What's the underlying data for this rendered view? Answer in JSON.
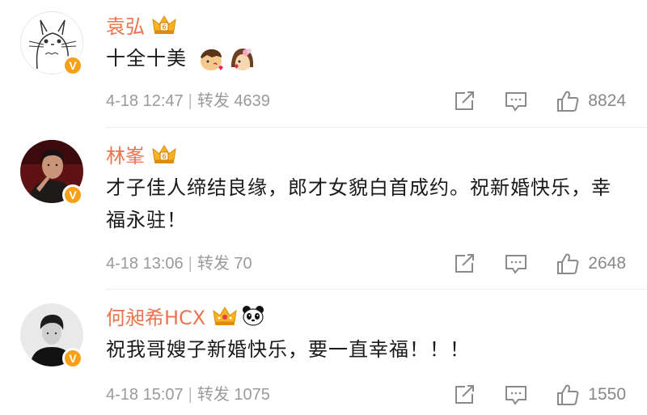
{
  "comments": [
    {
      "author": "袁弘",
      "text": "十全十美",
      "emojis": [
        "kiss-boy-emoji",
        "kiss-girl-emoji"
      ],
      "time": "4-18 12:47",
      "repost_label": "转发",
      "repost_count": "4639",
      "like_count": "8824",
      "avatar": "totoro-sketch-avatar"
    },
    {
      "author": "林峯",
      "text": "才子佳人缔结良缘，郎才女貌白首成约。祝新婚快乐，幸福永驻！",
      "time": "4-18 13:06",
      "repost_label": "转发",
      "repost_count": "70",
      "like_count": "2648",
      "avatar": "man-photo-avatar"
    },
    {
      "author": "何昶希HCX",
      "text": "祝我哥嫂子新婚快乐，要一直幸福！！！",
      "time": "4-18 15:07",
      "repost_label": "转发",
      "repost_count": "1075",
      "like_count": "1550",
      "avatar": "bw-portrait-avatar"
    }
  ],
  "verified_badge": "V",
  "colors": {
    "name": "#eb7350",
    "badge": "#f7a11a",
    "meta": "#9a9a9a",
    "text": "#1a1a1a"
  }
}
